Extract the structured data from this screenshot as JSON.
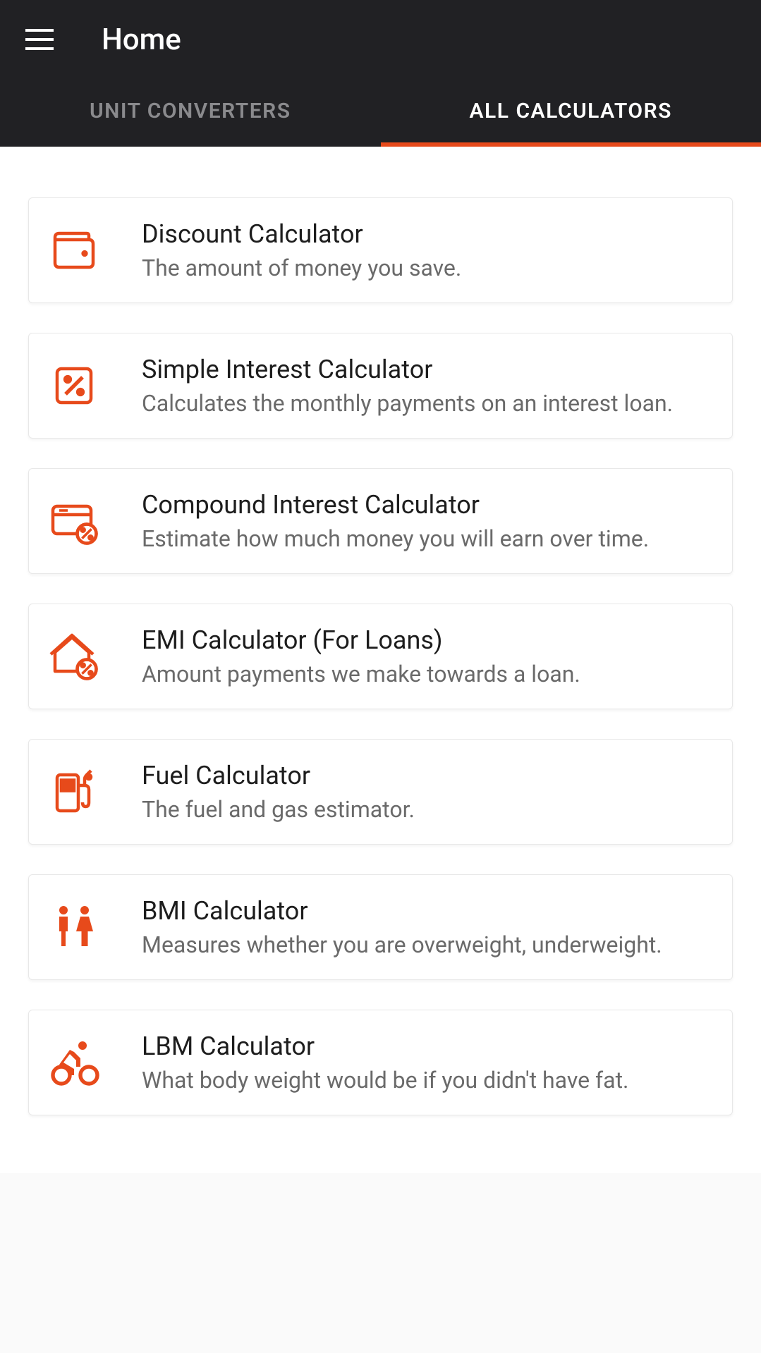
{
  "header": {
    "title": "Home"
  },
  "tabs": {
    "unit_converters": "UNIT CONVERTERS",
    "all_calculators": "ALL CALCULATORS",
    "active": "all_calculators"
  },
  "cards": [
    {
      "icon": "wallet-icon",
      "title": "Discount Calculator",
      "desc": "The amount of money you save."
    },
    {
      "icon": "percent-box-icon",
      "title": "Simple Interest Calculator",
      "desc": "Calculates the monthly payments on an interest loan."
    },
    {
      "icon": "card-percent-icon",
      "title": "Compound Interest Calculator",
      "desc": "Estimate how much money you will earn over time."
    },
    {
      "icon": "house-percent-icon",
      "title": "EMI Calculator (For Loans)",
      "desc": "Amount payments we make towards a loan."
    },
    {
      "icon": "fuel-icon",
      "title": "Fuel Calculator",
      "desc": "The fuel and gas estimator."
    },
    {
      "icon": "people-icon",
      "title": "BMI Calculator",
      "desc": "Measures whether you are overweight, underweight."
    },
    {
      "icon": "cyclist-icon",
      "title": "LBM Calculator",
      "desc": "What body weight would be if you didn't have fat."
    }
  ]
}
